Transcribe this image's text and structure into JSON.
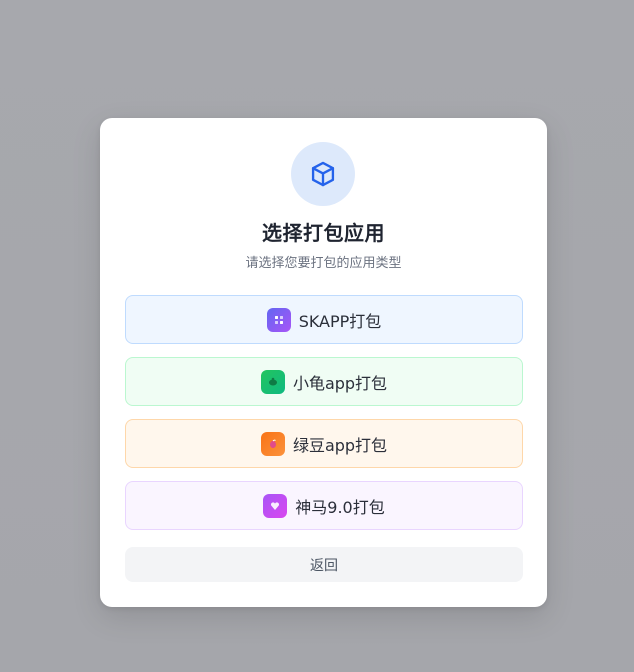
{
  "dialog": {
    "icon": "cube-icon",
    "title": "选择打包应用",
    "subtitle": "请选择您要打包的应用类型",
    "accent_color": "#2563eb"
  },
  "options": [
    {
      "label": "SKAPP打包",
      "icon": "sk-app-icon",
      "color": "#bfdbfe"
    },
    {
      "label": "小龟app打包",
      "icon": "turtle-app-icon",
      "color": "#bbf7d0"
    },
    {
      "label": "绿豆app打包",
      "icon": "bean-app-icon",
      "color": "#fed7aa"
    },
    {
      "label": "神马9.0打包",
      "icon": "shenma-app-icon",
      "color": "#e9d5ff"
    }
  ],
  "back_label": "返回"
}
